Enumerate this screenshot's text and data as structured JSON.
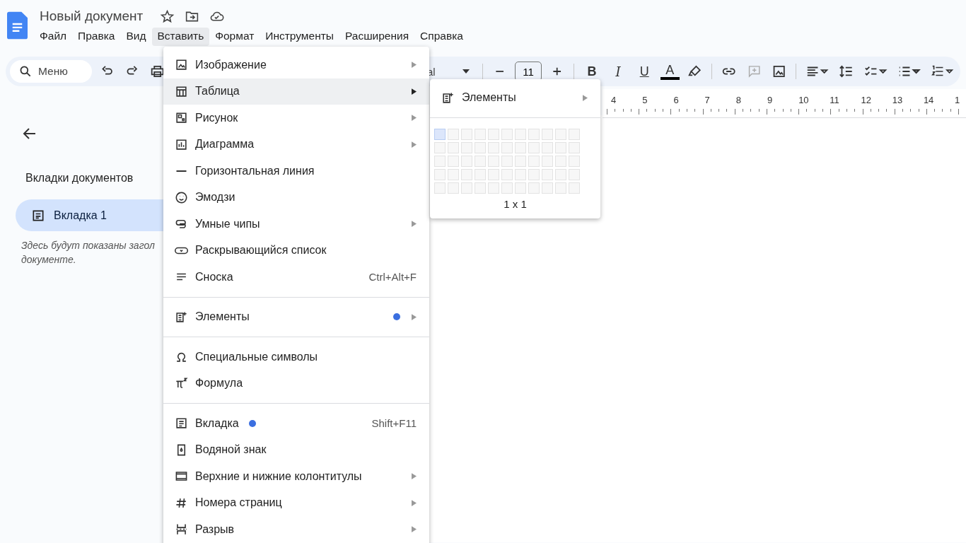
{
  "document": {
    "title": "Новый документ"
  },
  "menubar": [
    {
      "label": "Файл",
      "selected": false
    },
    {
      "label": "Правка",
      "selected": false
    },
    {
      "label": "Вид",
      "selected": false
    },
    {
      "label": "Вставить",
      "selected": true
    },
    {
      "label": "Формат",
      "selected": false
    },
    {
      "label": "Инструменты",
      "selected": false
    },
    {
      "label": "Расширения",
      "selected": false
    },
    {
      "label": "Справка",
      "selected": false
    }
  ],
  "toolbar": {
    "search_placeholder": "Меню",
    "font_visible": "al",
    "font_size": "11",
    "bold": "B",
    "italic": "I",
    "underline": "U",
    "text_color": "A"
  },
  "ruler": [
    "4",
    "5",
    "6",
    "7",
    "8",
    "9",
    "10",
    "11",
    "12",
    "13",
    "14",
    "1"
  ],
  "sidebar": {
    "heading": "Вкладки документов",
    "tabs": [
      {
        "label": "Вкладка 1",
        "selected": true
      }
    ],
    "hint": "Здесь будут показаны загол",
    "hint_line2": "документе."
  },
  "insert_menu": {
    "groups": [
      {
        "items": [
          {
            "kind": "image",
            "label": "Изображение",
            "submenu": true,
            "highlighted": false
          },
          {
            "kind": "table",
            "label": "Таблица",
            "submenu": true,
            "highlighted": true
          },
          {
            "kind": "drawing",
            "label": "Рисунок",
            "submenu": true,
            "highlighted": false
          },
          {
            "kind": "chart",
            "label": "Диаграмма",
            "submenu": true,
            "highlighted": false
          },
          {
            "kind": "hline",
            "label": "Горизонтальная линия",
            "submenu": false,
            "highlighted": false
          },
          {
            "kind": "emoji",
            "label": "Эмодзи",
            "submenu": false,
            "highlighted": false
          },
          {
            "kind": "chips",
            "label": "Умные чипы",
            "submenu": true,
            "highlighted": false
          },
          {
            "kind": "dropdown",
            "label": "Раскрывающийся список",
            "submenu": false,
            "highlighted": false
          },
          {
            "kind": "footnote",
            "label": "Сноска",
            "submenu": false,
            "highlighted": false,
            "shortcut": "Ctrl+Alt+F"
          }
        ]
      },
      {
        "items": [
          {
            "kind": "elements",
            "label": "Элементы",
            "submenu": true,
            "highlighted": false,
            "new_dot": true,
            "color": "#3b6fe0"
          }
        ]
      },
      {
        "items": [
          {
            "kind": "omega",
            "label": "Специальные символы",
            "submenu": false,
            "highlighted": false
          },
          {
            "kind": "pi",
            "label": "Формула",
            "submenu": false,
            "highlighted": false
          }
        ]
      },
      {
        "items": [
          {
            "kind": "tab",
            "label": "Вкладка",
            "submenu": false,
            "highlighted": false,
            "new_dot": true,
            "color": "#3b6fe0",
            "shortcut": "Shift+F11"
          },
          {
            "kind": "watermark",
            "label": "Водяной знак",
            "submenu": false,
            "highlighted": false
          },
          {
            "kind": "headers",
            "label": "Верхние и нижние колонтитулы",
            "submenu": true,
            "highlighted": false
          },
          {
            "kind": "hash",
            "label": "Номера страниц",
            "submenu": true,
            "highlighted": false
          },
          {
            "kind": "break",
            "label": "Разрыв",
            "submenu": true,
            "highlighted": false
          }
        ]
      }
    ]
  },
  "table_submenu": {
    "item": {
      "kind": "elements",
      "label": "Элементы",
      "submenu": true
    },
    "grid": [
      {
        "cells": [
          {
            "selected": true
          },
          {
            "selected": false
          },
          {
            "selected": false
          },
          {
            "selected": false
          },
          {
            "selected": false
          },
          {
            "selected": false
          },
          {
            "selected": false
          },
          {
            "selected": false
          },
          {
            "selected": false
          },
          {
            "selected": false
          },
          {
            "selected": false
          }
        ]
      },
      {
        "cells": [
          {
            "selected": false
          },
          {
            "selected": false
          },
          {
            "selected": false
          },
          {
            "selected": false
          },
          {
            "selected": false
          },
          {
            "selected": false
          },
          {
            "selected": false
          },
          {
            "selected": false
          },
          {
            "selected": false
          },
          {
            "selected": false
          },
          {
            "selected": false
          }
        ]
      },
      {
        "cells": [
          {
            "selected": false
          },
          {
            "selected": false
          },
          {
            "selected": false
          },
          {
            "selected": false
          },
          {
            "selected": false
          },
          {
            "selected": false
          },
          {
            "selected": false
          },
          {
            "selected": false
          },
          {
            "selected": false
          },
          {
            "selected": false
          },
          {
            "selected": false
          }
        ]
      },
      {
        "cells": [
          {
            "selected": false
          },
          {
            "selected": false
          },
          {
            "selected": false
          },
          {
            "selected": false
          },
          {
            "selected": false
          },
          {
            "selected": false
          },
          {
            "selected": false
          },
          {
            "selected": false
          },
          {
            "selected": false
          },
          {
            "selected": false
          },
          {
            "selected": false
          }
        ]
      },
      {
        "cells": [
          {
            "selected": false
          },
          {
            "selected": false
          },
          {
            "selected": false
          },
          {
            "selected": false
          },
          {
            "selected": false
          },
          {
            "selected": false
          },
          {
            "selected": false
          },
          {
            "selected": false
          },
          {
            "selected": false
          },
          {
            "selected": false
          },
          {
            "selected": false
          }
        ]
      }
    ],
    "size": "1 x 1"
  }
}
